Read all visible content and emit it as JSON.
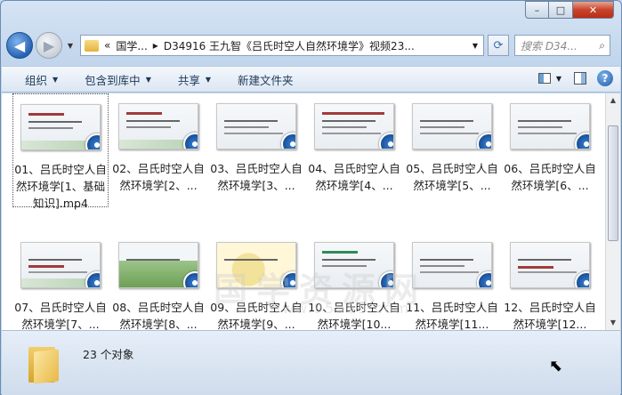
{
  "window": {
    "min_label": "–",
    "max_label": "□",
    "close_label": "✕"
  },
  "nav": {
    "back_label": "◀",
    "forward_label": "▶",
    "history_label": "▼",
    "address": {
      "prefix": "«",
      "crumb1": "国学...",
      "sep": "▸",
      "crumb2": "D34916 王九智《吕氏时空人自然环境学》视频23...",
      "dropdown": "▼"
    },
    "refresh_label": "⟳",
    "search_placeholder": "搜索 D34...",
    "search_icon": "⌕"
  },
  "toolbar": {
    "organize": "组织",
    "include_library": "包含到库中",
    "share": "共享",
    "new_folder": "新建文件夹",
    "dropdown": "▼",
    "help": "?"
  },
  "files": [
    {
      "label": "01、吕氏时空人自然环境学[1、基础知识].mp4"
    },
    {
      "label": "02、吕氏时空人自然环境学[2、..."
    },
    {
      "label": "03、吕氏时空人自然环境学[3、..."
    },
    {
      "label": "04、吕氏时空人自然环境学[4、..."
    },
    {
      "label": "05、吕氏时空人自然环境学[5、..."
    },
    {
      "label": "06、吕氏时空人自然环境学[6、..."
    },
    {
      "label": "07、吕氏时空人自然环境学[7、..."
    },
    {
      "label": "08、吕氏时空人自然环境学[8、..."
    },
    {
      "label": "09、吕氏时空人自然环境学[9、..."
    },
    {
      "label": "10、吕氏时空人自然环境学[10..."
    },
    {
      "label": "11、吕氏时空人自然环境学[11..."
    },
    {
      "label": "12、吕氏时空人自然环境学[12..."
    }
  ],
  "scroll": {
    "up": "▲",
    "down": "▼"
  },
  "details": {
    "count": "23 个对象"
  },
  "watermark": {
    "text": "国学资源网",
    "url": "www.95959.com"
  },
  "colors": {
    "accent": "#2f74c6",
    "close": "#c8442a"
  }
}
